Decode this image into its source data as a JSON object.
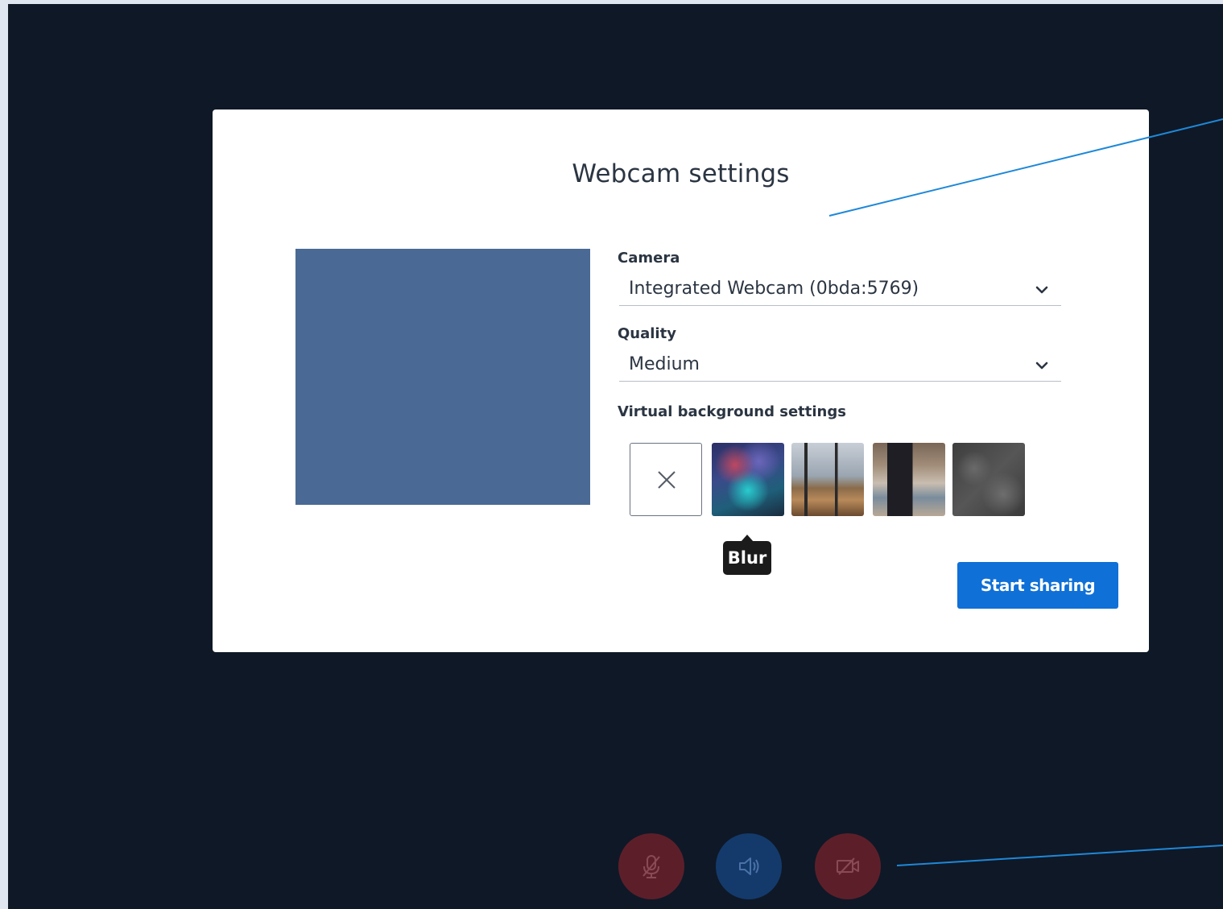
{
  "modal": {
    "title": "Webcam settings",
    "camera_label": "Camera",
    "camera_value": "Integrated Webcam (0bda:5769)",
    "quality_label": "Quality",
    "quality_value": "Medium",
    "vbg_label": "Virtual background settings",
    "backgrounds": [
      {
        "name": "none",
        "icon": "close-icon"
      },
      {
        "name": "blur"
      },
      {
        "name": "home"
      },
      {
        "name": "office"
      },
      {
        "name": "stone"
      }
    ],
    "tooltip": "Blur",
    "start_button": "Start sharing"
  },
  "controls": [
    {
      "name": "microphone-muted",
      "icon": "mic-off-icon",
      "color": "#5c1f2a"
    },
    {
      "name": "audio",
      "icon": "speaker-icon",
      "color": "#143a6b"
    },
    {
      "name": "video-muted",
      "icon": "video-off-icon",
      "color": "#5c1f2a"
    }
  ],
  "colors": {
    "page_background": "#0f1826",
    "preview": "#4a6994",
    "primary": "#0f70d7",
    "annotation": "#1e88d8"
  }
}
